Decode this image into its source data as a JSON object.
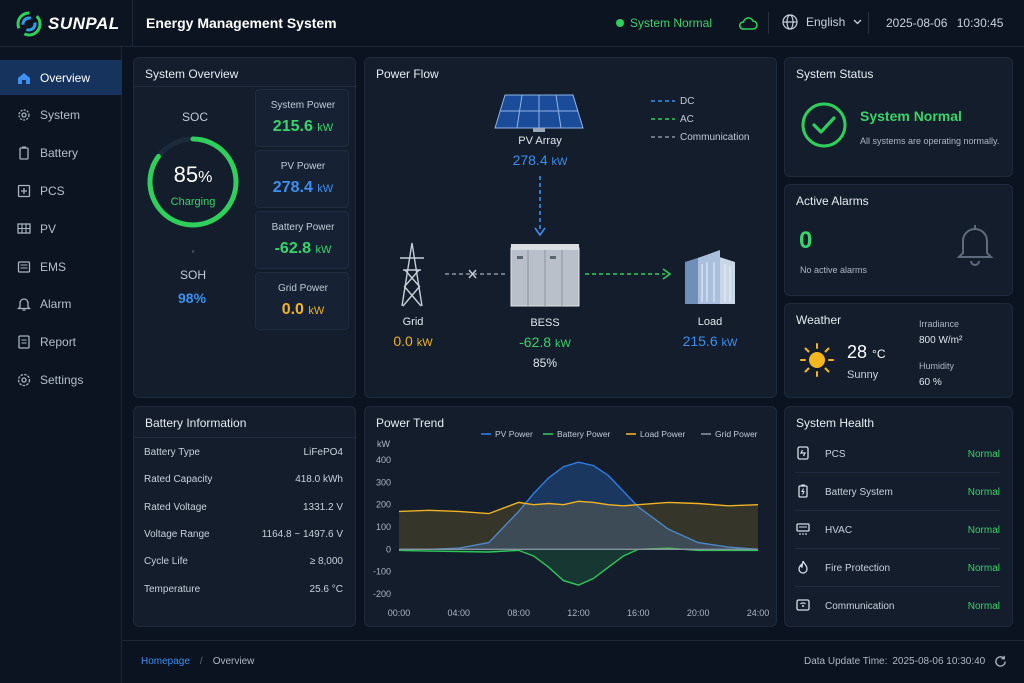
{
  "header": {
    "brand": "SUNPAL",
    "title": "Energy Management System",
    "status": "System Normal",
    "language": "English",
    "date": "2025-08-06",
    "time": "10:30:45"
  },
  "sidebar": {
    "items": [
      {
        "label": "Overview",
        "icon": "home-icon",
        "active": true
      },
      {
        "label": "System",
        "icon": "gear-icon"
      },
      {
        "label": "Battery",
        "icon": "battery-icon"
      },
      {
        "label": "PCS",
        "icon": "pcs-icon"
      },
      {
        "label": "PV",
        "icon": "solar-panel-icon"
      },
      {
        "label": "EMS",
        "icon": "ems-icon"
      },
      {
        "label": "Alarm",
        "icon": "alarm-icon"
      },
      {
        "label": "Report",
        "icon": "report-icon"
      },
      {
        "label": "Settings",
        "icon": "settings-icon"
      }
    ]
  },
  "overview": {
    "title": "System Overview",
    "soc_label": "SOC",
    "soc_value": "85",
    "soc_unit": "%",
    "soc_fraction": 0.85,
    "soc_state": "Charging",
    "soh_label": "SOH",
    "soh_value": "98%",
    "metrics": [
      {
        "label": "System Power",
        "value": "215.6",
        "unit": "kW",
        "color": "#38d46a"
      },
      {
        "label": "PV Power",
        "value": "278.4",
        "unit": "kW",
        "color": "#3d8ff0"
      },
      {
        "label": "Battery Power",
        "value": "-62.8",
        "unit": "kW",
        "color": "#38d46a"
      },
      {
        "label": "Grid Power",
        "value": "0.0",
        "unit": "kW",
        "color": "#f0b323"
      }
    ]
  },
  "flow": {
    "title": "Power Flow",
    "legend": [
      "DC",
      "AC",
      "Communication"
    ],
    "pv": {
      "name": "PV Array",
      "value": "278.4",
      "unit": "kW"
    },
    "grid": {
      "name": "Grid",
      "value": "0.0",
      "unit": "kW"
    },
    "bess": {
      "name": "BESS",
      "value": "-62.8",
      "unit": "kW",
      "soc": "85%"
    },
    "load": {
      "name": "Load",
      "value": "215.6",
      "unit": "kW"
    }
  },
  "status": {
    "title": "System Status",
    "headline": "System Normal",
    "desc": "All systems are operating normally."
  },
  "alarms": {
    "title": "Active Alarms",
    "count": "0",
    "desc": "No active alarms"
  },
  "weather": {
    "title": "Weather",
    "temp": "28",
    "temp_unit": "°C",
    "condition": "Sunny",
    "irr_label": "Irradiance",
    "irr_value": "800 W/m²",
    "hum_label": "Humidity",
    "hum_value": "60 %"
  },
  "battery_info": {
    "title": "Battery Information",
    "rows": [
      {
        "label": "Battery Type",
        "value": "LiFePO4"
      },
      {
        "label": "Rated Capacity",
        "value": "418.0 kWh"
      },
      {
        "label": "Rated Voltage",
        "value": "1331.2 V"
      },
      {
        "label": "Voltage Range",
        "value": "1164.8 ~ 1497.6 V"
      },
      {
        "label": "Cycle Life",
        "value": "≥ 8,000"
      },
      {
        "label": "Temperature",
        "value": "25.6 °C"
      }
    ]
  },
  "health": {
    "title": "System Health",
    "rows": [
      {
        "label": "PCS",
        "status": "Normal",
        "icon": "pcs-device-icon"
      },
      {
        "label": "Battery System",
        "status": "Normal",
        "icon": "battery-system-icon"
      },
      {
        "label": "HVAC",
        "status": "Normal",
        "icon": "hvac-icon"
      },
      {
        "label": "Fire Protection",
        "status": "Normal",
        "icon": "fire-protection-icon"
      },
      {
        "label": "Communication",
        "status": "Normal",
        "icon": "communication-icon"
      }
    ]
  },
  "chart_data": {
    "type": "area",
    "title": "Power Trend",
    "ylabel": "kW",
    "ylim": [
      -200,
      400
    ],
    "yticks": [
      400,
      300,
      200,
      100,
      0,
      -100,
      -200
    ],
    "x": [
      "00:00",
      "02:00",
      "04:00",
      "06:00",
      "08:00",
      "09:00",
      "10:00",
      "11:00",
      "12:00",
      "13:00",
      "14:00",
      "15:00",
      "16:00",
      "18:00",
      "20:00",
      "22:00",
      "24:00"
    ],
    "xtick_labels": [
      "00:00",
      "04:00",
      "08:00",
      "12:00",
      "16:00",
      "20:00",
      "24:00"
    ],
    "series": [
      {
        "name": "PV Power",
        "color": "#2f7fe6",
        "values": [
          0,
          0,
          5,
          30,
          170,
          250,
          320,
          370,
          390,
          375,
          330,
          260,
          190,
          90,
          30,
          10,
          0
        ]
      },
      {
        "name": "Battery Power",
        "color": "#2fc85a",
        "values": [
          -5,
          -8,
          -10,
          -12,
          -5,
          -30,
          -80,
          -140,
          -160,
          -130,
          -80,
          -30,
          0,
          5,
          -5,
          -5,
          -5
        ]
      },
      {
        "name": "Load Power",
        "color": "#f0b323",
        "values": [
          170,
          175,
          170,
          160,
          210,
          200,
          205,
          200,
          215,
          210,
          200,
          195,
          200,
          210,
          205,
          195,
          200
        ]
      },
      {
        "name": "Grid Power",
        "color": "#8892a0",
        "values": [
          0,
          0,
          0,
          0,
          0,
          0,
          0,
          0,
          0,
          0,
          0,
          0,
          0,
          0,
          0,
          0,
          0
        ]
      }
    ],
    "legend": "top-right",
    "grid": false
  },
  "footer": {
    "crumb_home": "Homepage",
    "crumb_sep": "/",
    "crumb_current": "Overview",
    "update_label": "Data Update Time:",
    "update_value": "2025-08-06 10:30:40"
  }
}
